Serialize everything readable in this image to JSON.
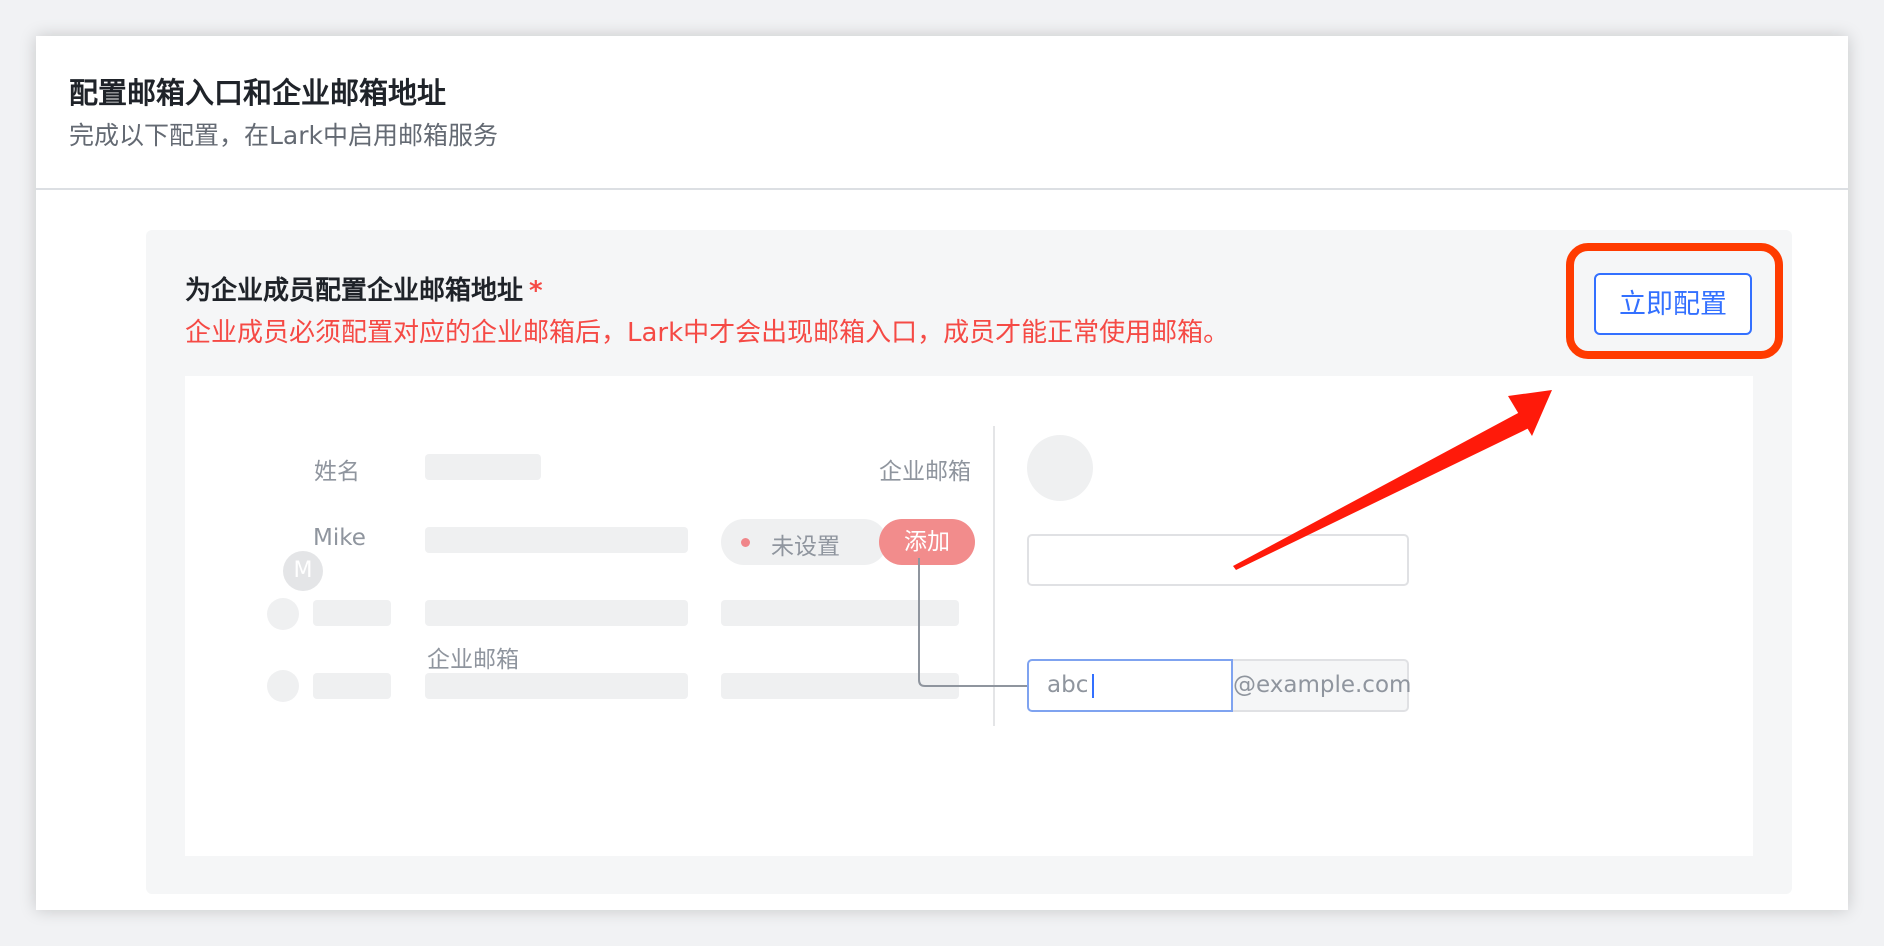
{
  "header": {
    "title": "配置邮箱入口和企业邮箱地址",
    "subtitle": "完成以下配置，在Lark中启用邮箱服务"
  },
  "section": {
    "title": "为企业成员配置企业邮箱地址",
    "required_mark": "*",
    "warning": "企业成员必须配置对应的企业邮箱后，Lark中才会出现邮箱入口，成员才能正常使用邮箱。",
    "config_button_label": "立即配置"
  },
  "preview": {
    "col_name_label": "姓名",
    "col_email_label": "企业邮箱",
    "row1": {
      "avatar_initial": "M",
      "name": "Mike",
      "status": "未设置",
      "add_label": "添加"
    },
    "inline_email_label": "企业邮箱",
    "email_input_value": "abc",
    "email_domain": "@example.com"
  },
  "colors": {
    "accent_blue": "#3370ff",
    "warning_red": "#f54a45",
    "highlight_orange": "#ff3b00",
    "arrow_red": "#ff1a0a"
  }
}
